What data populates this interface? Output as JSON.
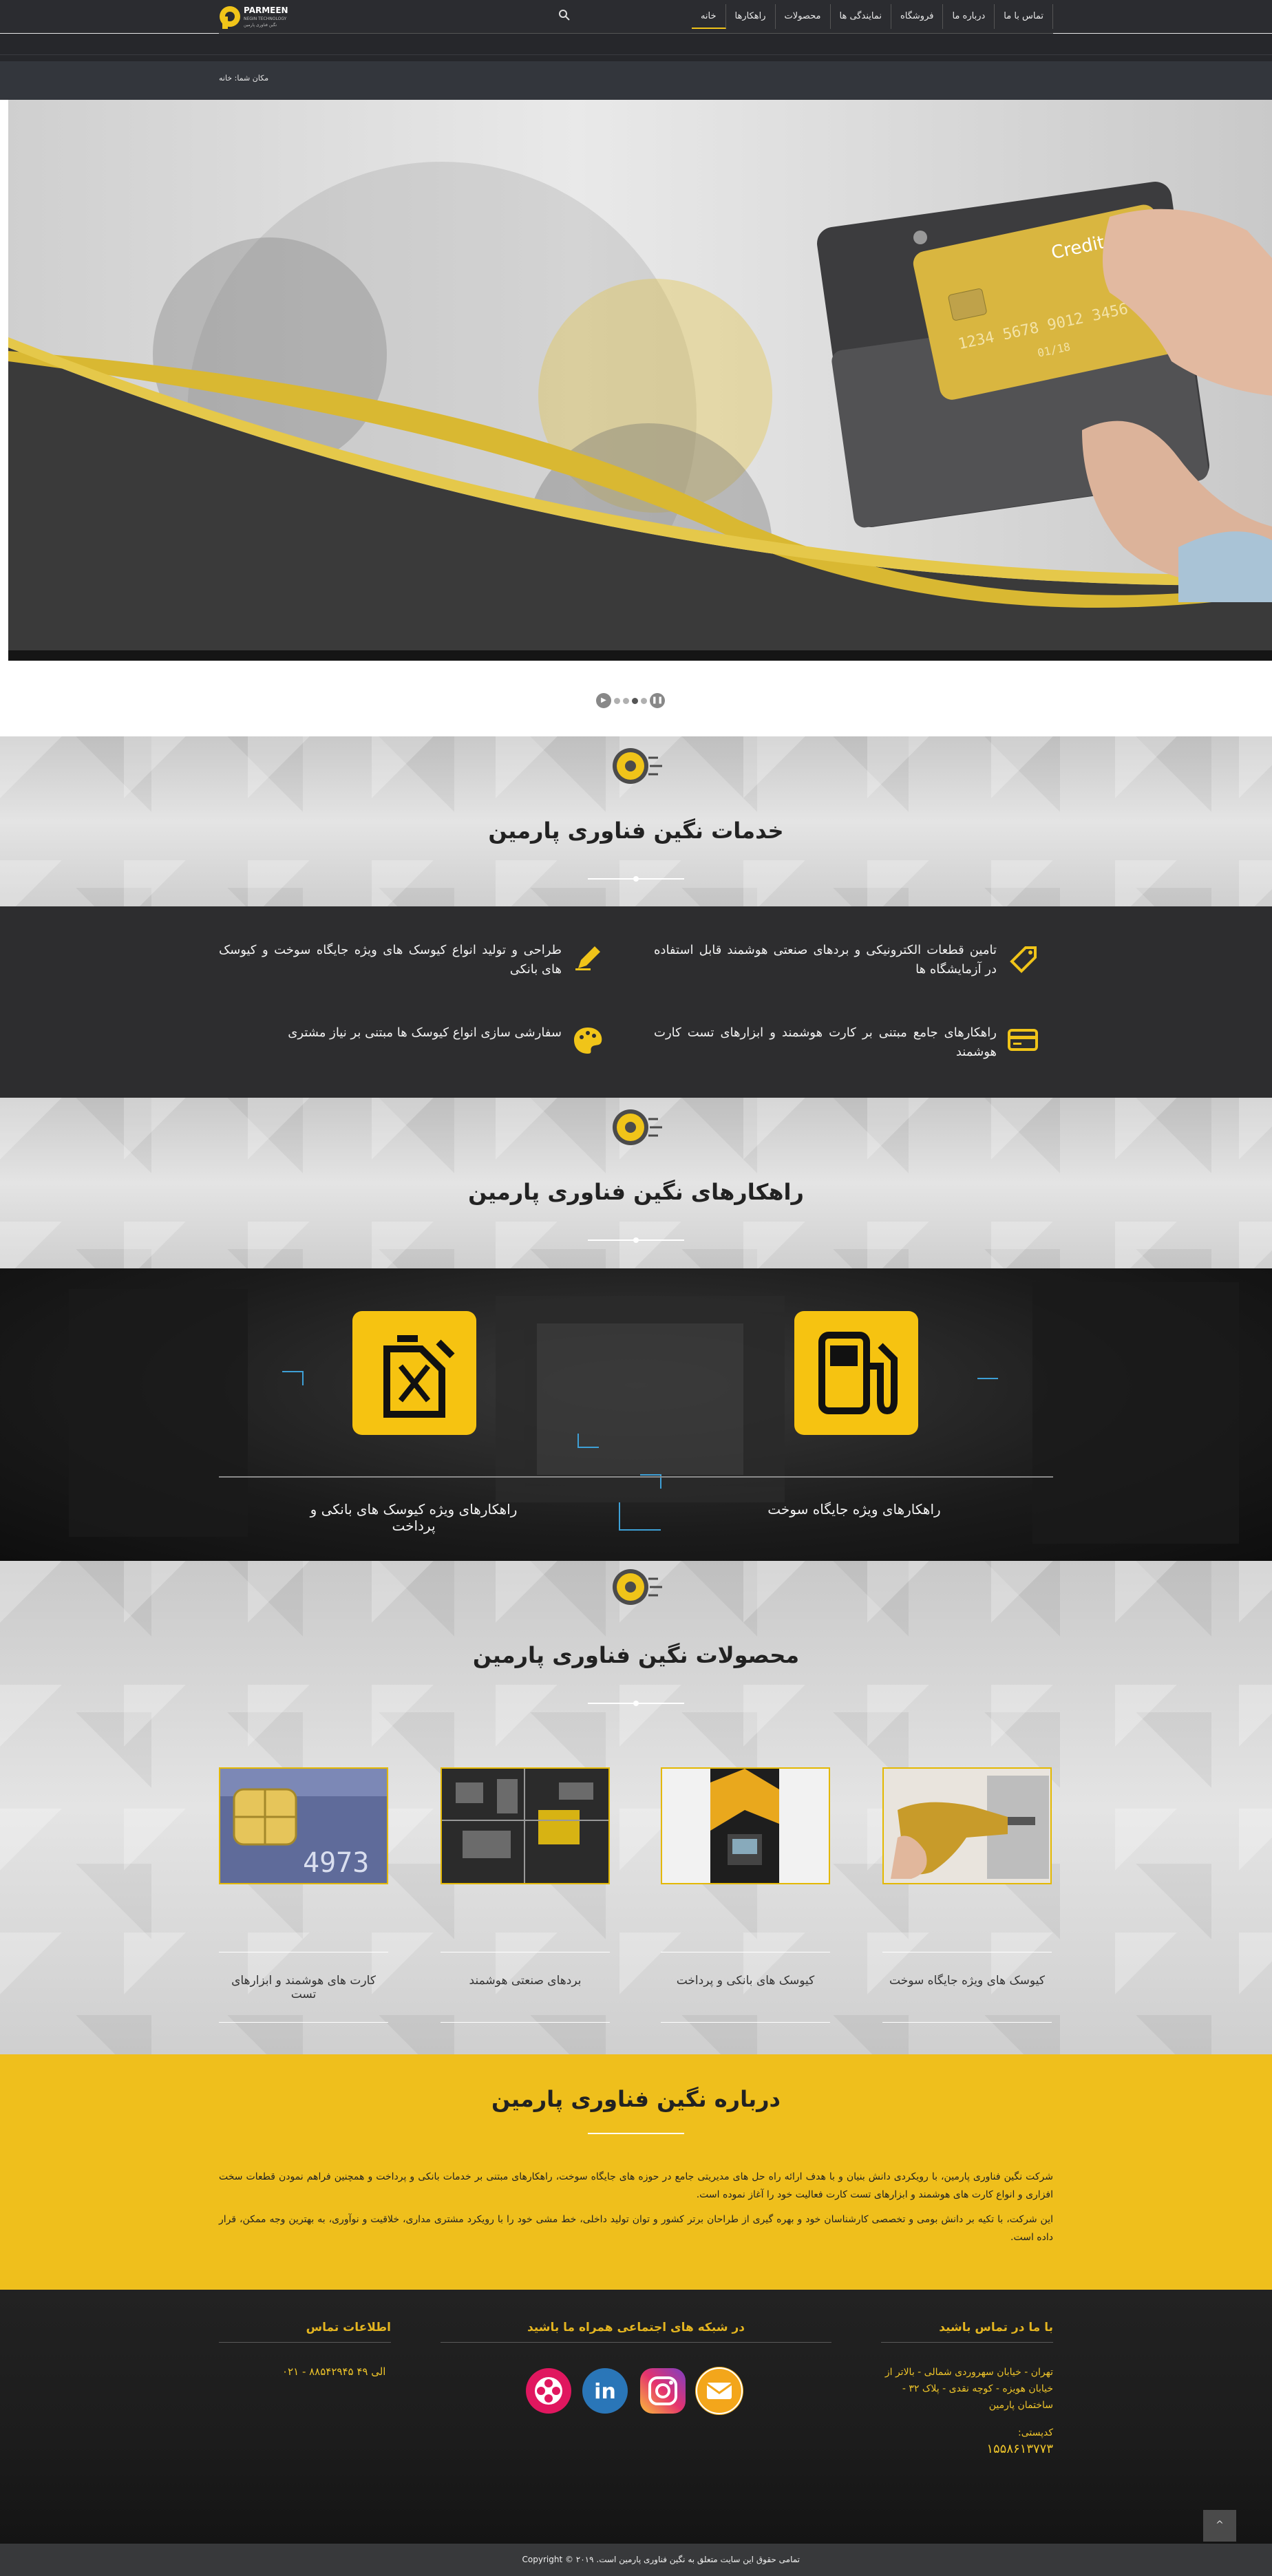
{
  "header": {
    "nav": [
      "خانه",
      "راهکارها",
      "محصولات",
      "نمایندگی ها",
      "فروشگاه",
      "درباره ما",
      "تماس با ما"
    ],
    "logo_text": "PARMEEN",
    "logo_sub": "NEGIN TECHNOLOGY",
    "logo_fa": "نگین فناوری پارمین"
  },
  "breadcrumb": "مکان شما: خانه",
  "slider": {
    "card_text": "Credit Ca",
    "card_number": "1234 5678 9012 3456",
    "card_date": "01/18"
  },
  "services": {
    "title": "خدمات نگین فناوری پارمین",
    "items": [
      {
        "text": "تامین قطعات الکترونیکی و بردهای صنعتی هوشمند قابل استفاده در آزمایشگاه ها",
        "icon": "tag-icon"
      },
      {
        "text": "طراحی و تولید انواع کیوسک های ویژه جایگاه سوخت و کیوسک های بانکی",
        "icon": "pencil-icon"
      },
      {
        "text": "راهکارهای جامع مبتنی بر کارت هوشمند و ابزارهای تست کارت هوشمند",
        "icon": "card-icon"
      },
      {
        "text": "سفارشی سازی انواع کیوسک ها مبتنی بر نیاز مشتری",
        "icon": "palette-icon"
      }
    ]
  },
  "solutions": {
    "title": "راهکارهای نگین فناوری پارمین",
    "items": [
      {
        "label": "راهکارهای ویژه جایگاه سوخت",
        "icon": "fuel-pump-icon"
      },
      {
        "label": "راهکارهای ویژه کیوسک های بانکی و پرداخت",
        "icon": "jerrycan-icon"
      }
    ]
  },
  "products": {
    "title": "محصولات نگین فناوری پارمین",
    "items": [
      {
        "label": "کیوسک های ویژه جایگاه سوخت"
      },
      {
        "label": "کیوسک های بانکی و پرداخت"
      },
      {
        "label": "بردهای صنعتی هوشمند"
      },
      {
        "label": "کارت های هوشمند و ابزارهای تست"
      }
    ]
  },
  "about": {
    "title": "درباره نگین فناوری پارمین",
    "p1": "شرکت نگین فناوری پارمین، با رویکردی دانش بنیان و با هدف ارائه راه حل های مدیریتی جامع در حوزه های جایگاه سوخت، راهکارهای مبتنی بر خدمات بانکی و پرداخت و همچنین فراهم نمودن قطعات سخت افزاری و انواع کارت های هوشمند و ابزارهای تست کارت فعالیت خود را آغاز نموده است.",
    "p2": "این شرکت، با تکیه بر دانش بومی و تخصصی کارشناسان خود و بهره گیری از طراحان برتر کشور و توان تولید داخلی، خط مشی خود را با رویکرد مشتری مداری، خلاقیت و نوآوری، به بهترین وجه ممکن، قرار داده است."
  },
  "footer": {
    "contact_title": "با ما در تماس باشید",
    "address": "تهران - خیابان سهروردی شمالی - بالاتر از خیابان هویزه - کوچه نقدی - پلاک ۳۲ - ساختمان پارمین",
    "postal_label": "کدپستی:",
    "postal_code": "۱۵۵۸۶۱۳۷۷۳",
    "social_title": "در شبکه های اجتماعی همراه ما باشید",
    "info_title": "اطلاعات تماس",
    "phone": "۰۲۱ - ۸۸۵۴۲۹۴۵ الی ۴۹",
    "copyright": "تمامی حقوق این سایت متعلق به نگین فناوری پارمین است. Copyright © ۲۰۱۹",
    "to_top": "^"
  },
  "colors": {
    "accent": "#f0c419",
    "dark": "#2d2d2f",
    "yellow": "#efbf1c"
  }
}
